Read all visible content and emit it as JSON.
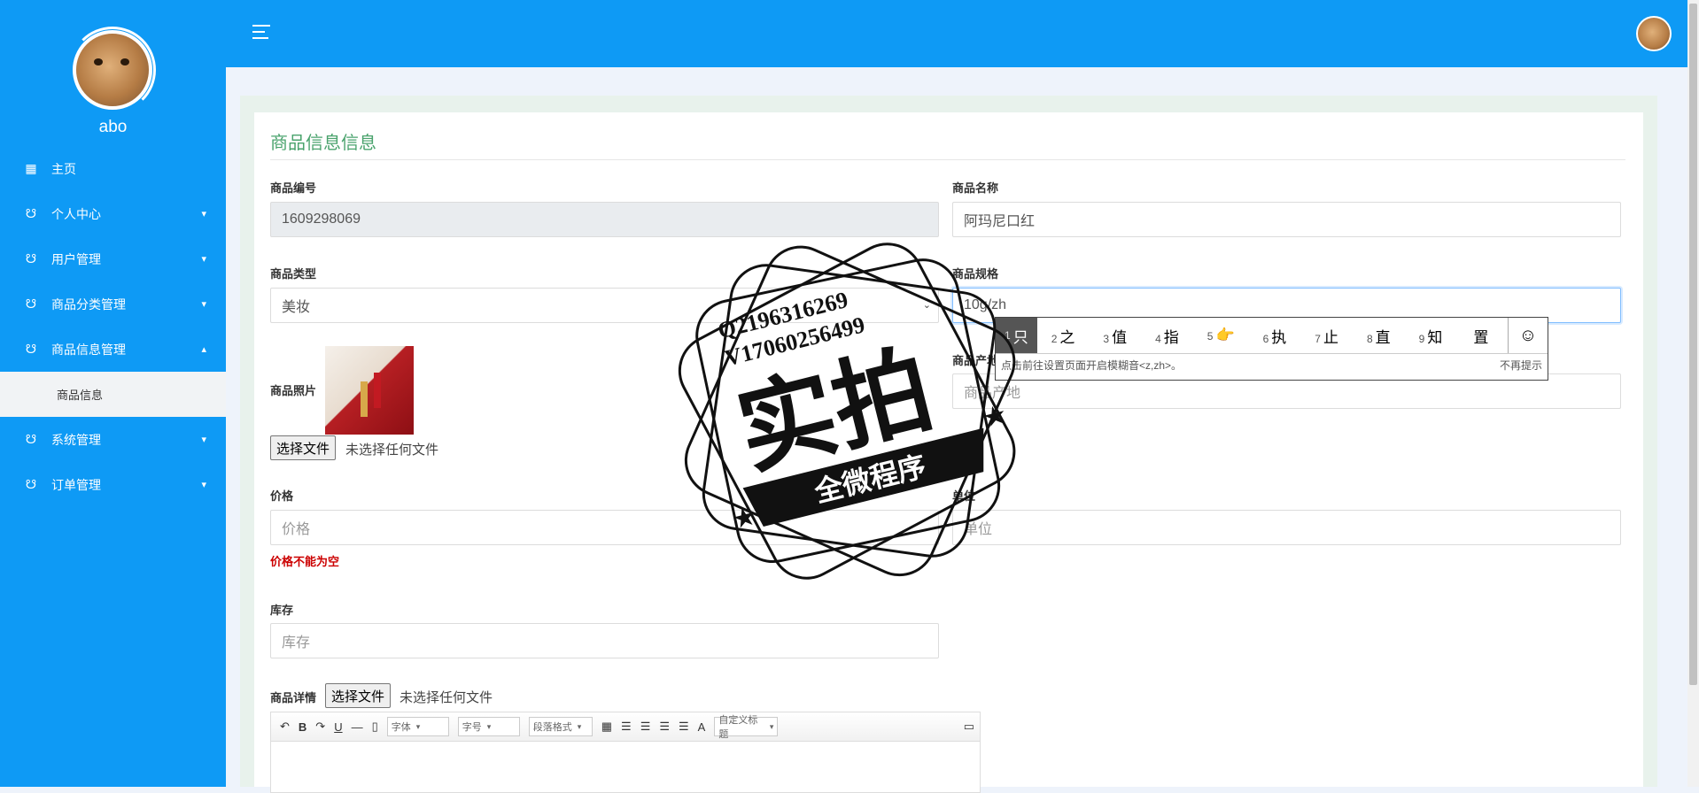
{
  "sidebar": {
    "username": "abo",
    "items": [
      {
        "label": "主页",
        "icon": "grid-icon",
        "glyph": "▦"
      },
      {
        "label": "个人中心",
        "icon": "stethoscope-icon",
        "glyph": "☋",
        "chevron": "▾"
      },
      {
        "label": "用户管理",
        "icon": "stethoscope-icon",
        "glyph": "☋",
        "chevron": "▾"
      },
      {
        "label": "商品分类管理",
        "icon": "stethoscope-icon",
        "glyph": "☋",
        "chevron": "▾"
      },
      {
        "label": "商品信息管理",
        "icon": "stethoscope-icon",
        "glyph": "☋",
        "chevron": "▴"
      },
      {
        "label": "系统管理",
        "icon": "stethoscope-icon",
        "glyph": "☋",
        "chevron": "▾"
      },
      {
        "label": "订单管理",
        "icon": "stethoscope-icon",
        "glyph": "☋",
        "chevron": "▾"
      }
    ],
    "sub_item": "商品信息"
  },
  "header": {
    "menu_icon": "hamburger-icon"
  },
  "form": {
    "title": "商品信息信息",
    "product_no_label": "商品编号",
    "product_no_value": "1609298069",
    "product_name_label": "商品名称",
    "product_name_value": "阿玛尼口红",
    "type_label": "商品类型",
    "type_value": "美妆",
    "spec_label": "商品规格",
    "spec_value": "10g/zh",
    "origin_label": "商品产地",
    "origin_placeholder": "商品产地",
    "photo_label": "商品照片",
    "file_button": "选择文件",
    "file_none": "未选择任何文件",
    "price_label": "价格",
    "price_placeholder": "价格",
    "price_error": "价格不能为空",
    "unit_label": "单位",
    "unit_placeholder": "单位",
    "stock_label": "库存",
    "stock_placeholder": "库存",
    "detail_label": "商品详情",
    "detail_file_button": "选择文件",
    "detail_file_none": "未选择任何文件"
  },
  "editor": {
    "font_select": "字体",
    "size_select": "字号",
    "para_select": "段落格式",
    "custom_select": "自定义标题",
    "bold": "B",
    "underline": "U",
    "font_color": "A"
  },
  "ime": {
    "candidates": [
      {
        "n": "1",
        "c": "只"
      },
      {
        "n": "2",
        "c": "之"
      },
      {
        "n": "3",
        "c": "值"
      },
      {
        "n": "4",
        "c": "指"
      },
      {
        "n": "5",
        "c": "👉"
      },
      {
        "n": "6",
        "c": "执"
      },
      {
        "n": "7",
        "c": "止"
      },
      {
        "n": "8",
        "c": "直"
      },
      {
        "n": "9",
        "c": "知"
      },
      {
        "n": "",
        "c": "置"
      }
    ],
    "emoji": "☺",
    "hint": "点击前往设置页面开启模糊音<z,zh>。",
    "dismiss": "不再提示"
  },
  "watermark": {
    "line1": "Q2196316269",
    "line2": "V17060256499",
    "big": "实拍",
    "banner": "全微程序"
  }
}
